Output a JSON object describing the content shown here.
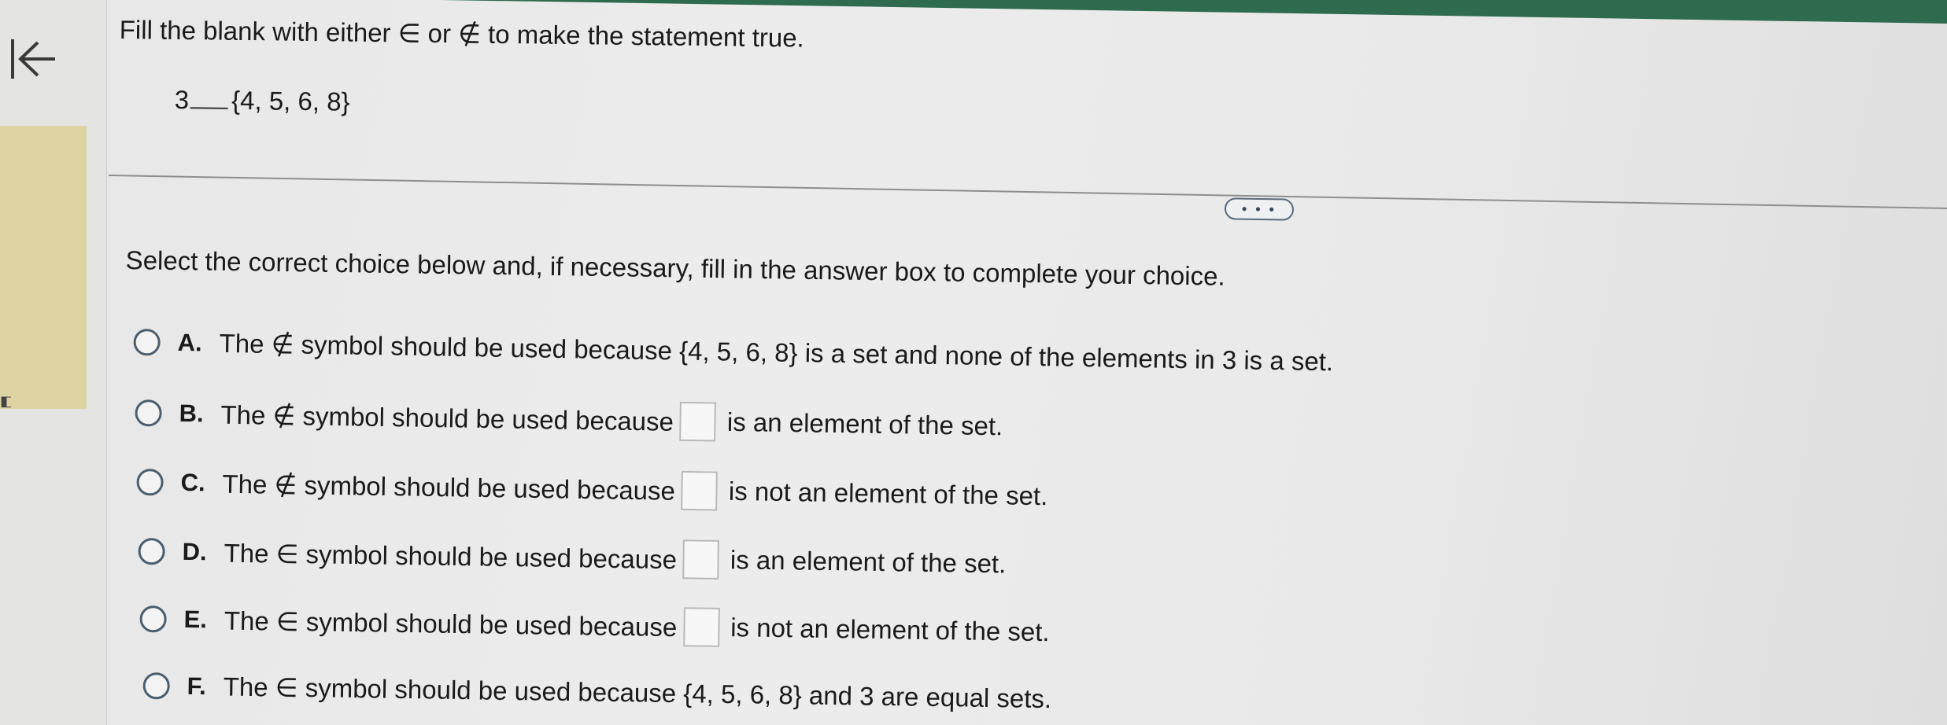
{
  "question": {
    "prompt": "Fill the blank with either ∈ or ∉ to make the statement true.",
    "element": "3",
    "set": "{4, 5, 6, 8}"
  },
  "more_button": {
    "label": "• • •"
  },
  "instructions": "Select the correct choice below and, if necessary, fill in the answer box to complete your choice.",
  "choices": [
    {
      "letter": "A.",
      "text": "The ∉ symbol should be used because {4, 5, 6, 8} is a set and none of the elements in 3 is a set."
    },
    {
      "letter": "B.",
      "before": "The ∉ symbol should be used because",
      "after": "is an element of the set."
    },
    {
      "letter": "C.",
      "before": "The ∉ symbol should be used because",
      "after": "is not an element of the set."
    },
    {
      "letter": "D.",
      "before": "The ∈ symbol should be used because",
      "after": "is an element of the set."
    },
    {
      "letter": "E.",
      "before": "The ∈ symbol should be used because",
      "after": "is not an element of the set."
    },
    {
      "letter": "F.",
      "text": "The ∈ symbol should be used because {4, 5, 6, 8} and 3 are equal sets."
    }
  ],
  "icons": {
    "back": "back-to-start-icon"
  },
  "colors": {
    "accent_green": "#2e6b4f",
    "sidebar_tan": "#ddd3a3",
    "radio_border": "#4b5e6e"
  }
}
